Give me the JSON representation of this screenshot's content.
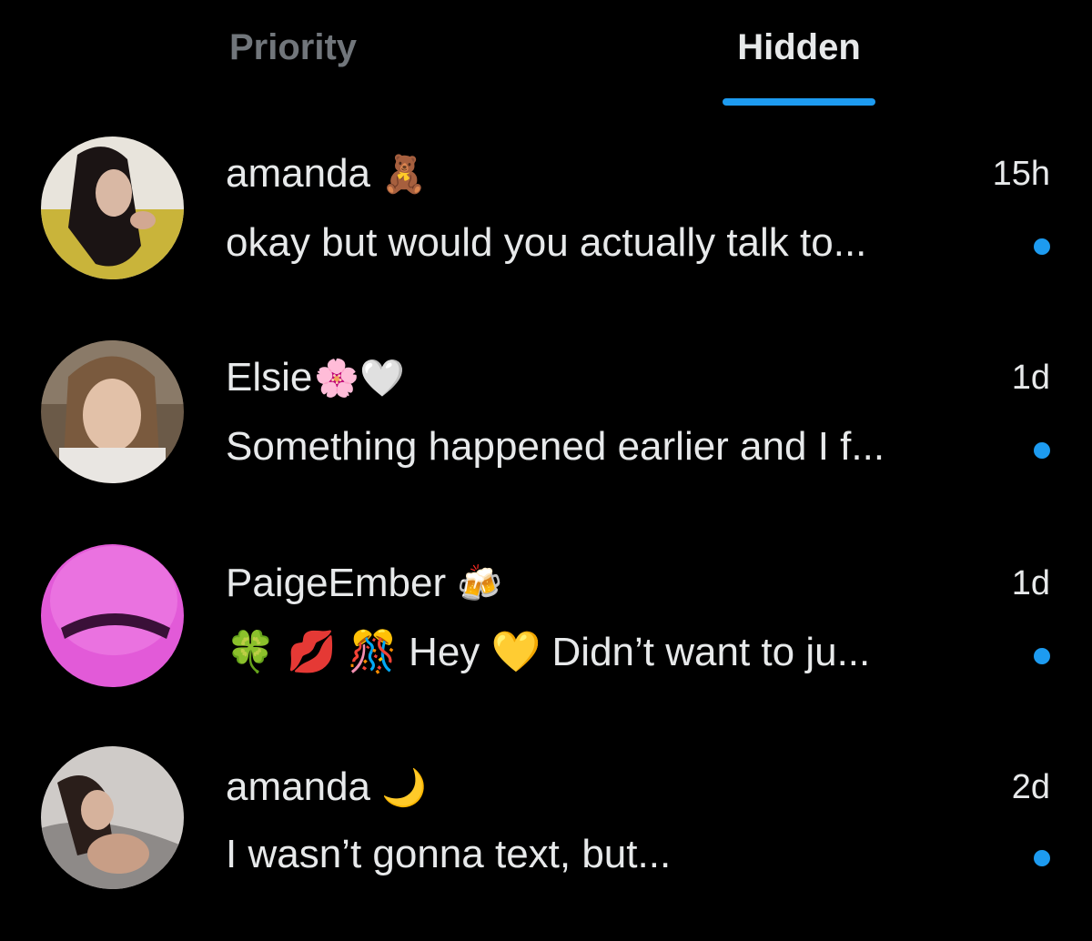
{
  "tabs": {
    "priority": "Priority",
    "hidden": "Hidden",
    "active": "Hidden"
  },
  "colors": {
    "background": "#000000",
    "accent": "#1d9bf0",
    "text_primary": "#e7e9ea",
    "text_muted": "#71767b"
  },
  "conversations": [
    {
      "name": "amanda",
      "name_emoji": "🧸",
      "time": "15h",
      "preview": "okay but would you actually talk to...",
      "unread": true,
      "avatar": "photo-avatar"
    },
    {
      "name": "Elsie",
      "name_emoji": "🌸🤍",
      "time": "1d",
      "preview": "Something happened earlier and I f...",
      "unread": true,
      "avatar": "photo-avatar"
    },
    {
      "name": "PaigeEmber",
      "name_emoji": "🍻",
      "time": "1d",
      "preview_emojis": "🍀  💋  🎊",
      "preview": "Hey 💛 Didn’t want to ju...",
      "unread": true,
      "avatar": "pink-avatar"
    },
    {
      "name": "amanda",
      "name_emoji": "🌙",
      "time": "2d",
      "preview": "I wasn’t gonna text, but...",
      "unread": true,
      "avatar": "photo-avatar"
    }
  ]
}
